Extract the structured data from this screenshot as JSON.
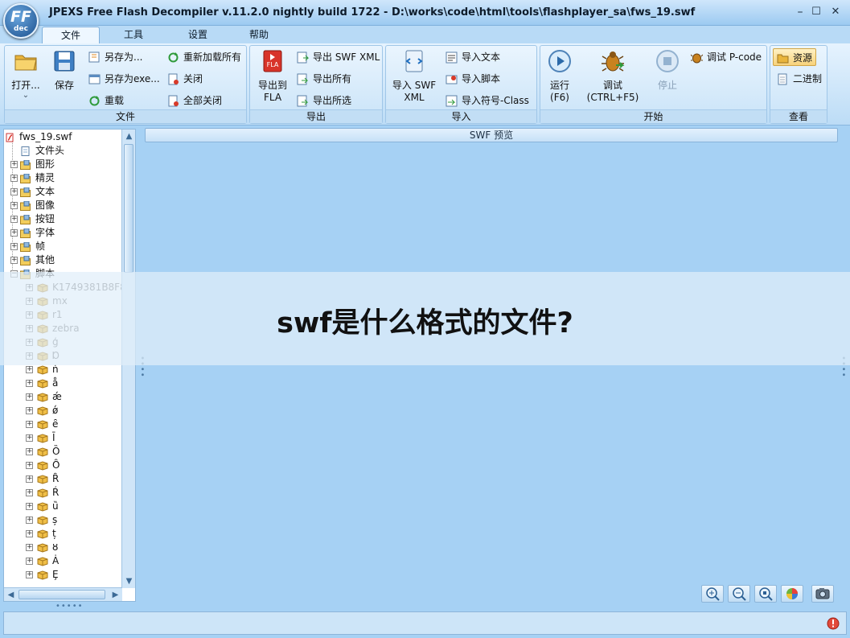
{
  "window": {
    "title": "JPEXS Free Flash Decompiler v.11.2.0 nightly build 1722 - D:\\works\\code\\html\\tools\\flashplayer_sa\\fws_19.swf",
    "logo_top": "FF",
    "logo_bottom": "dec",
    "minimize": "–",
    "maximize": "☐",
    "close": "✕"
  },
  "tabs": [
    {
      "label": "文件",
      "active": true
    },
    {
      "label": "工具"
    },
    {
      "label": "设置"
    },
    {
      "label": "帮助"
    }
  ],
  "ribbon": {
    "file": {
      "label": "文件",
      "open": "打开...",
      "open_arrow": "⌄",
      "save": "保存",
      "save_as": "另存为...",
      "save_as_exe": "另存为exe...",
      "reload": "重载",
      "reload_all": "重新加载所有",
      "close": "关闭",
      "close_all": "全部关闭"
    },
    "export": {
      "label": "导出",
      "to_fla": "导出到\nFLA",
      "fla_badge": "FLA",
      "swf_xml": "导出 SWF XML",
      "all": "导出所有",
      "selected": "导出所选"
    },
    "import": {
      "label": "导入",
      "swf_xml": "导入 SWF\nXML",
      "text": "导入文本",
      "script": "导入脚本",
      "symbol_class": "导入符号-Class"
    },
    "start": {
      "label": "开始",
      "run": "运行\n(F6)",
      "debug": "调试\n(CTRL+F5)",
      "stop": "停止",
      "debug_pcode": "调试 P-code"
    },
    "view": {
      "label": "查看",
      "resources": "资源",
      "binary": "二进制"
    }
  },
  "tree": [
    {
      "label": "fws_19.swf",
      "level": 0,
      "icon": "swf-icon"
    },
    {
      "label": "文件头",
      "level": 1,
      "icon": "header-icon"
    },
    {
      "label": "图形",
      "level": 1,
      "icon": "shapes-folder-icon",
      "exp": true
    },
    {
      "label": "精灵",
      "level": 1,
      "icon": "sprites-folder-icon",
      "exp": true
    },
    {
      "label": "文本",
      "level": 1,
      "icon": "texts-folder-icon",
      "exp": true
    },
    {
      "label": "图像",
      "level": 1,
      "icon": "images-folder-icon",
      "exp": true
    },
    {
      "label": "按钮",
      "level": 1,
      "icon": "buttons-folder-icon",
      "exp": true
    },
    {
      "label": "字体",
      "level": 1,
      "icon": "fonts-folder-icon",
      "exp": true
    },
    {
      "label": "帧",
      "level": 1,
      "icon": "frames-folder-icon",
      "exp": true
    },
    {
      "label": "其他",
      "level": 1,
      "icon": "others-folder-icon",
      "exp": true
    },
    {
      "label": "脚本",
      "level": 1,
      "icon": "scripts-folder-icon",
      "exp": true,
      "open": true
    },
    {
      "label": "K1749381B8F8",
      "level": 2,
      "icon": "package-icon",
      "exp": true
    },
    {
      "label": "mx",
      "level": 2,
      "icon": "package-icon",
      "exp": true
    },
    {
      "label": "r1",
      "level": 2,
      "icon": "package-icon",
      "exp": true
    },
    {
      "label": "zebra",
      "level": 2,
      "icon": "package-icon",
      "exp": true
    },
    {
      "label": "ģ",
      "level": 2,
      "icon": "package-icon",
      "exp": true
    },
    {
      "label": "Ɒ",
      "level": 2,
      "icon": "package-icon",
      "exp": true
    },
    {
      "label": "ṅ",
      "level": 2,
      "icon": "package-icon",
      "exp": true
    },
    {
      "label": "å",
      "level": 2,
      "icon": "package-icon",
      "exp": true
    },
    {
      "label": "ǽ",
      "level": 2,
      "icon": "package-icon",
      "exp": true
    },
    {
      "label": "ǿ",
      "level": 2,
      "icon": "package-icon",
      "exp": true
    },
    {
      "label": "ȇ",
      "level": 2,
      "icon": "package-icon",
      "exp": true
    },
    {
      "label": "Ī",
      "level": 2,
      "icon": "package-icon",
      "exp": true
    },
    {
      "label": "Ȍ",
      "level": 2,
      "icon": "package-icon",
      "exp": true
    },
    {
      "label": "Ȏ",
      "level": 2,
      "icon": "package-icon",
      "exp": true
    },
    {
      "label": "Ȓ",
      "level": 2,
      "icon": "package-icon",
      "exp": true
    },
    {
      "label": "Ŕ",
      "level": 2,
      "icon": "package-icon",
      "exp": true
    },
    {
      "label": "ȕ",
      "level": 2,
      "icon": "package-icon",
      "exp": true
    },
    {
      "label": "ș",
      "level": 2,
      "icon": "package-icon",
      "exp": true
    },
    {
      "label": "ț",
      "level": 2,
      "icon": "package-icon",
      "exp": true
    },
    {
      "label": "ȣ",
      "level": 2,
      "icon": "package-icon",
      "exp": true
    },
    {
      "label": "Ȧ",
      "level": 2,
      "icon": "package-icon",
      "exp": true
    },
    {
      "label": "Ȩ",
      "level": 2,
      "icon": "package-icon",
      "exp": true
    }
  ],
  "preview": {
    "label": "SWF 预览"
  },
  "banner": {
    "text": "swf是什么格式的文件?"
  },
  "scroll": {
    "up": "▲",
    "down": "▼",
    "left": "◀",
    "right": "▶"
  }
}
